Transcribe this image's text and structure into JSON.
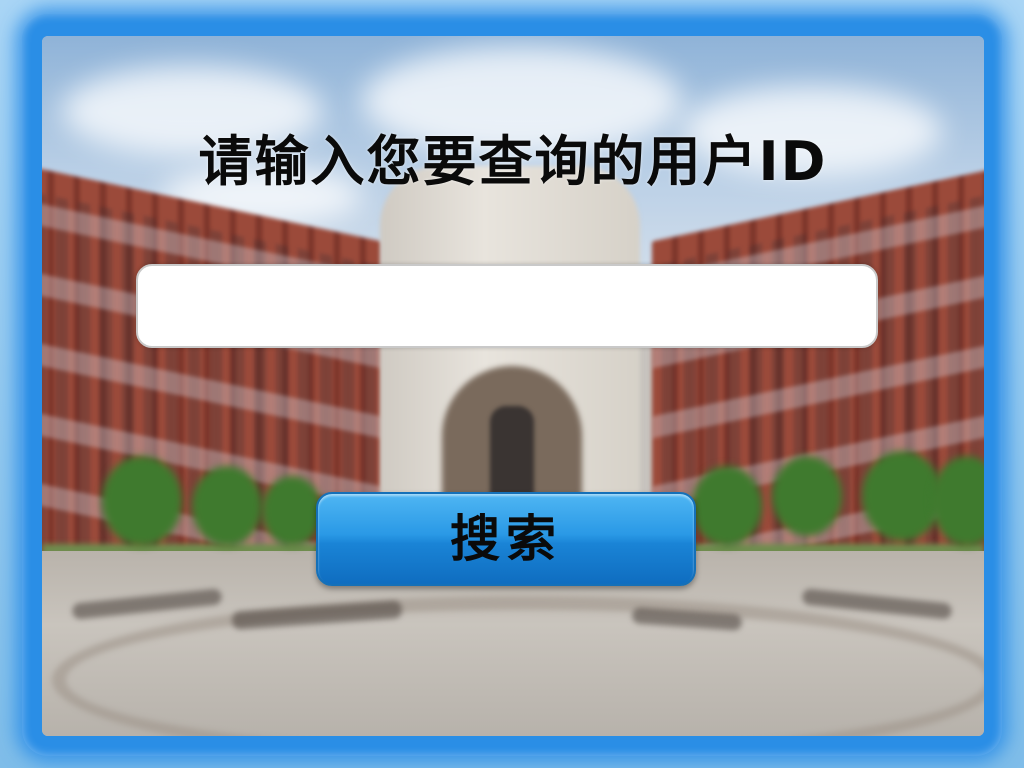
{
  "page": {
    "title": "请输入您要查询的用户ID"
  },
  "search": {
    "value": "",
    "button_label": "搜索"
  },
  "theme": {
    "frame_color": "#2a8ee6",
    "button_color": "#1a84d6",
    "text_color": "#0a0a0a"
  }
}
